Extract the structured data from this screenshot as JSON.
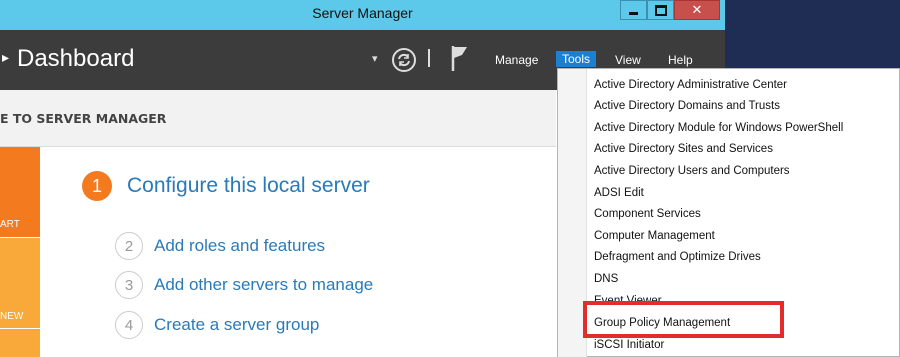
{
  "window": {
    "title": "Server Manager",
    "controls": {
      "minimize": "▁",
      "maximize": "☐",
      "close": "✕"
    }
  },
  "header": {
    "title": "Dashboard"
  },
  "menu": {
    "manage": "Manage",
    "tools": "Tools",
    "view": "View",
    "help": "Help"
  },
  "welcome": {
    "text": "E TO SERVER MANAGER"
  },
  "tiles": {
    "quick_start": "ART",
    "whats_new": "NEW"
  },
  "steps": [
    {
      "num": "1",
      "label": "Configure this local server"
    },
    {
      "num": "2",
      "label": "Add roles and features"
    },
    {
      "num": "3",
      "label": "Add other servers to manage"
    },
    {
      "num": "4",
      "label": "Create a server group"
    }
  ],
  "tools_menu": {
    "items": [
      "Active Directory Administrative Center",
      "Active Directory Domains and Trusts",
      "Active Directory Module for Windows PowerShell",
      "Active Directory Sites and Services",
      "Active Directory Users and Computers",
      "ADSI Edit",
      "Component Services",
      "Computer Management",
      "Defragment and Optimize Drives",
      "DNS",
      "Event Viewer",
      "Group Policy Management",
      "iSCSI Initiator"
    ],
    "highlighted": "Group Policy Management"
  },
  "colors": {
    "titlebar": "#5cc8ea",
    "header": "#3c3c3c",
    "accent_orange": "#f47a20",
    "link_blue": "#2a7ab9",
    "tools_active": "#1c7fcf",
    "highlight_box": "#e32d2d"
  }
}
